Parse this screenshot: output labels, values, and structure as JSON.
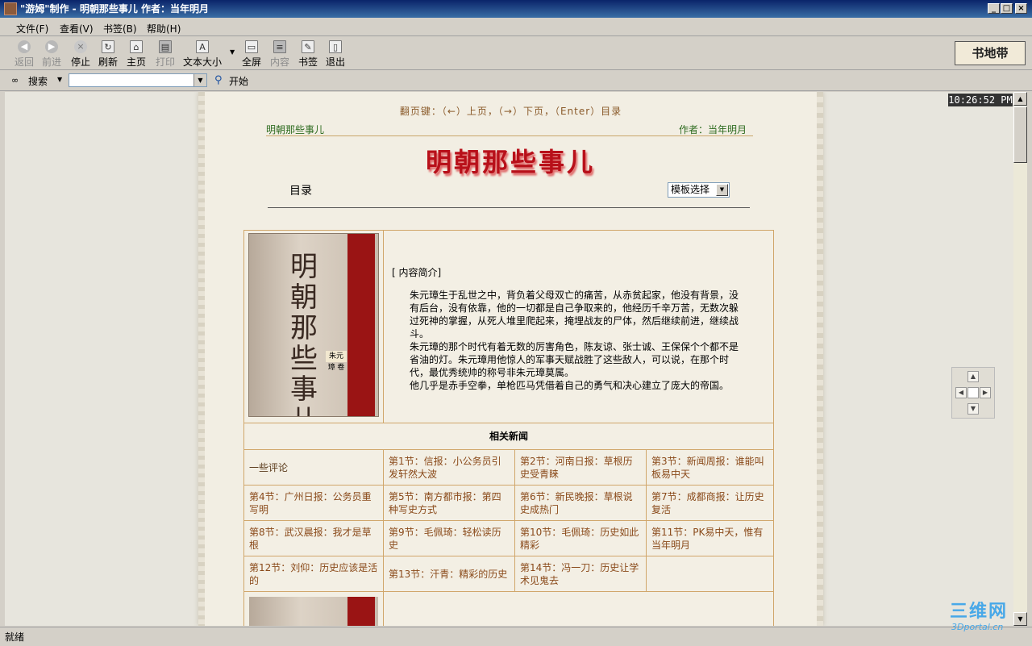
{
  "window": {
    "title": "\"游姆\"制作 - 明朝那些事儿 作者：当年明月",
    "minimize": "_",
    "maximize": "□",
    "close": "×"
  },
  "menu": [
    "文件(F)",
    "查看(V)",
    "书签(B)",
    "帮助(H)"
  ],
  "toolbar": {
    "back": "返回",
    "forward": "前进",
    "stop": "停止",
    "refresh": "刷新",
    "home": "主页",
    "print": "打印",
    "textsize": "文本大小",
    "fullscreen": "全屏",
    "contents": "内容",
    "bookmark": "书签",
    "exit": "退出"
  },
  "logo": "书地带",
  "search": {
    "label": "搜索",
    "value": "",
    "go": "开始"
  },
  "page": {
    "clock": "10:26:52 PM",
    "hint": "翻页键：（←）上页，（→）下页，（Enter）目录",
    "book_name": "明朝那些事儿",
    "author": "作者：当年明月",
    "big_title": "明朝那些事儿",
    "toc_label": "目录",
    "template_select": "模板选择",
    "cover_title": "明朝那些事儿",
    "cover_author": "朱元璋 卷",
    "intro_title": "[ 内容简介]",
    "intro_para1": "朱元璋生于乱世之中，背负着父母双亡的痛苦，从赤贫起家，他没有背景，没有后台，没有依靠，他的一切都是自己争取来的，他经历千辛万苦，无数次躲过死神的掌握，从死人堆里爬起来，掩埋战友的尸体，然后继续前进，继续战斗。",
    "intro_para2": "朱元璋的那个时代有着无数的厉害角色，陈友谅、张士诚、王保保个个都不是省油的灯。朱元璋用他惊人的军事天赋战胜了这些敌人，可以说，在那个时代，最优秀统帅的称号非朱元璋莫属。",
    "intro_para3": "他几乎是赤手空拳，单枪匹马凭借着自己的勇气和决心建立了庞大的帝国。",
    "news_header": "相关新闻",
    "news": [
      [
        "一些评论",
        "第1节：信报：小公务员引发轩然大波",
        "第2节：河南日报：草根历史受青睐",
        "第3节：新闻周报：谁能叫板易中天"
      ],
      [
        "第4节：广州日报：公务员重写明",
        "第5节：南方都市报：第四种写史方式",
        "第6节：新民晚报：草根说史成热门",
        "第7节：成都商报：让历史复活"
      ],
      [
        "第8节：武汉晨报：我才是草根",
        "第9节：毛佩琦：轻松读历史",
        "第10节：毛佩琦：历史如此精彩",
        "第11节：PK易中天，惟有当年明月"
      ],
      [
        "第12节：刘仰：历史应该是活的",
        "第13节：汗青：精彩的历史",
        "第14节：冯一刀：历史让学术见鬼去",
        ""
      ]
    ]
  },
  "status": "就绪",
  "watermark": "三维网",
  "watermark_sub": "3Dportal.cn"
}
